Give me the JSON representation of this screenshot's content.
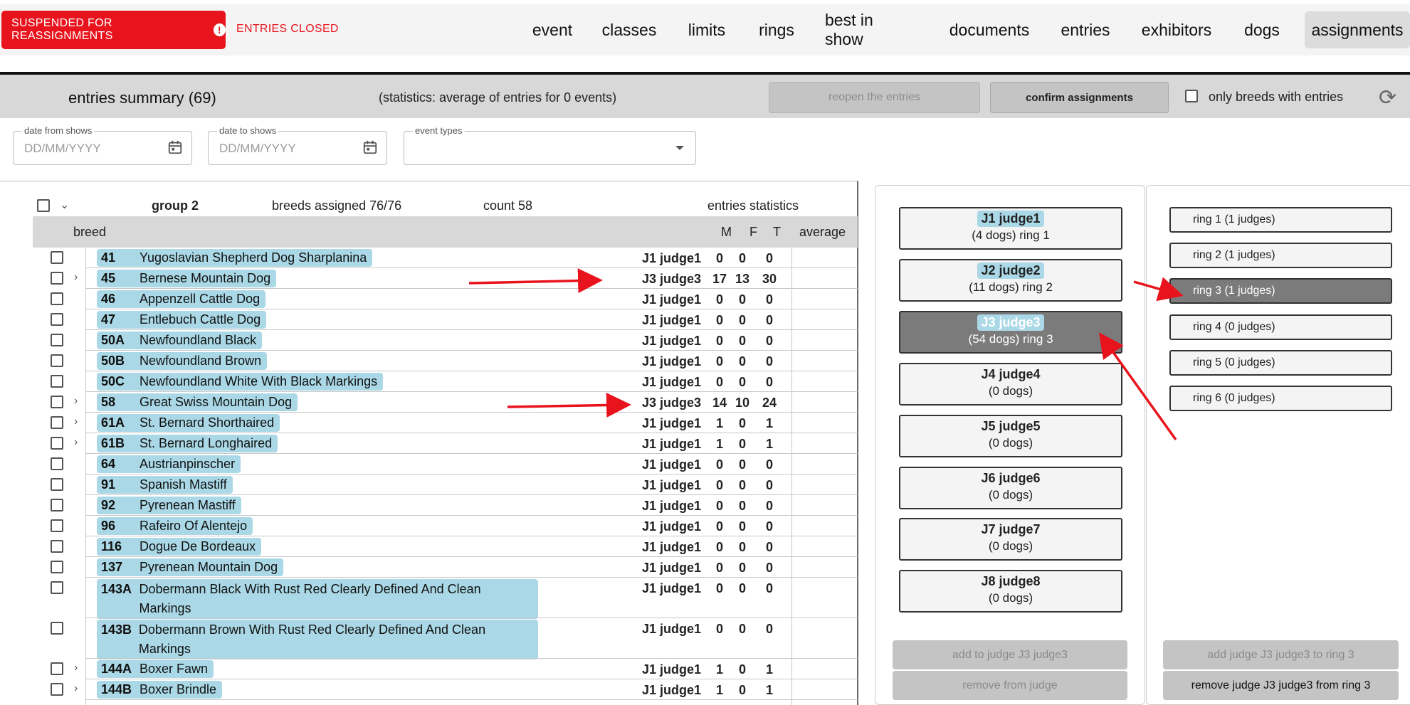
{
  "header": {
    "status_badge": "SUSPENDED FOR REASSIGNMENTS",
    "status_icon": "!",
    "entries_closed": "ENTRIES CLOSED",
    "nav": [
      "event",
      "classes",
      "limits",
      "rings",
      "best in show",
      "documents",
      "entries",
      "exhibitors",
      "dogs",
      "assignments"
    ],
    "active_nav": "assignments"
  },
  "summary": {
    "title": "entries summary (69)",
    "stats": "(statistics: average of entries for 0 events)",
    "reopen": "reopen the entries",
    "confirm": "confirm assignments",
    "only_breeds": "only breeds with entries",
    "refresh_icon": "refresh-icon"
  },
  "filters": {
    "date_from_label": "date from shows",
    "date_from_placeholder": "DD/MM/YYYY",
    "date_to_label": "date to shows",
    "date_to_placeholder": "DD/MM/YYYY",
    "event_types_label": "event types",
    "event_types_value": ""
  },
  "group": {
    "name": "group 2",
    "assigned": "breeds assigned 76/76",
    "count": "count 58",
    "stats": "entries statistics"
  },
  "table": {
    "breed_header": "breed",
    "m_header": "M",
    "f_header": "F",
    "t_header": "T",
    "avg_header": "average",
    "rows": [
      {
        "num": "41",
        "name": "Yugoslavian Shepherd Dog Sharplanina",
        "judge": "J1 judge1",
        "m": "0",
        "f": "0",
        "t": "0",
        "exp": false
      },
      {
        "num": "45",
        "name": "Bernese Mountain Dog",
        "judge": "J3 judge3",
        "m": "17",
        "f": "13",
        "t": "30",
        "exp": true
      },
      {
        "num": "46",
        "name": "Appenzell Cattle Dog",
        "judge": "J1 judge1",
        "m": "0",
        "f": "0",
        "t": "0",
        "exp": false
      },
      {
        "num": "47",
        "name": "Entlebuch Cattle Dog",
        "judge": "J1 judge1",
        "m": "0",
        "f": "0",
        "t": "0",
        "exp": false
      },
      {
        "num": "50A",
        "name": "Newfoundland Black",
        "judge": "J1 judge1",
        "m": "0",
        "f": "0",
        "t": "0",
        "exp": false
      },
      {
        "num": "50B",
        "name": "Newfoundland Brown",
        "judge": "J1 judge1",
        "m": "0",
        "f": "0",
        "t": "0",
        "exp": false
      },
      {
        "num": "50C",
        "name": "Newfoundland White With Black Markings",
        "judge": "J1 judge1",
        "m": "0",
        "f": "0",
        "t": "0",
        "exp": false
      },
      {
        "num": "58",
        "name": "Great Swiss Mountain Dog",
        "judge": "J3 judge3",
        "m": "14",
        "f": "10",
        "t": "24",
        "exp": true
      },
      {
        "num": "61A",
        "name": "St. Bernard Shorthaired",
        "judge": "J1 judge1",
        "m": "1",
        "f": "0",
        "t": "1",
        "exp": true
      },
      {
        "num": "61B",
        "name": "St. Bernard Longhaired",
        "judge": "J1 judge1",
        "m": "1",
        "f": "0",
        "t": "1",
        "exp": true
      },
      {
        "num": "64",
        "name": "Austrianpinscher",
        "judge": "J1 judge1",
        "m": "0",
        "f": "0",
        "t": "0",
        "exp": false
      },
      {
        "num": "91",
        "name": "Spanish Mastiff",
        "judge": "J1 judge1",
        "m": "0",
        "f": "0",
        "t": "0",
        "exp": false
      },
      {
        "num": "92",
        "name": "Pyrenean Mastiff",
        "judge": "J1 judge1",
        "m": "0",
        "f": "0",
        "t": "0",
        "exp": false
      },
      {
        "num": "96",
        "name": "Rafeiro Of Alentejo",
        "judge": "J1 judge1",
        "m": "0",
        "f": "0",
        "t": "0",
        "exp": false
      },
      {
        "num": "116",
        "name": "Dogue De Bordeaux",
        "judge": "J1 judge1",
        "m": "0",
        "f": "0",
        "t": "0",
        "exp": false
      },
      {
        "num": "137",
        "name": "Pyrenean Mountain Dog",
        "judge": "J1 judge1",
        "m": "0",
        "f": "0",
        "t": "0",
        "exp": false
      },
      {
        "num": "143A",
        "name": "Dobermann Black With Rust Red Clearly Defined And Clean Markings",
        "judge": "J1 judge1",
        "m": "0",
        "f": "0",
        "t": "0",
        "exp": false,
        "tall": true
      },
      {
        "num": "143B",
        "name": "Dobermann Brown With Rust Red Clearly Defined And Clean Markings",
        "judge": "J1 judge1",
        "m": "0",
        "f": "0",
        "t": "0",
        "exp": false,
        "tall": true
      },
      {
        "num": "144A",
        "name": "Boxer Fawn",
        "judge": "J1 judge1",
        "m": "1",
        "f": "0",
        "t": "1",
        "exp": true
      },
      {
        "num": "144B",
        "name": "Boxer Brindle",
        "judge": "J1 judge1",
        "m": "1",
        "f": "0",
        "t": "1",
        "exp": true
      }
    ]
  },
  "judges": [
    {
      "name": "J1 judge1",
      "sub": "(4 dogs) ring 1",
      "hl": true
    },
    {
      "name": "J2 judge2",
      "sub": "(11 dogs) ring 2",
      "hl": true
    },
    {
      "name": "J3 judge3",
      "sub": "(54 dogs) ring 3",
      "hl": true,
      "selected": true
    },
    {
      "name": "J4 judge4",
      "sub": "(0 dogs)"
    },
    {
      "name": "J5 judge5",
      "sub": "(0 dogs)"
    },
    {
      "name": "J6 judge6",
      "sub": "(0 dogs)"
    },
    {
      "name": "J7 judge7",
      "sub": "(0 dogs)"
    },
    {
      "name": "J8 judge8",
      "sub": "(0 dogs)"
    }
  ],
  "rings": [
    {
      "name": "ring 1 (1 judges)"
    },
    {
      "name": "ring 2 (1 judges)"
    },
    {
      "name": "ring 3 (1 judges)",
      "selected": true
    },
    {
      "name": "ring 4 (0 judges)"
    },
    {
      "name": "ring 5 (0 judges)"
    },
    {
      "name": "ring 6 (0 judges)"
    }
  ],
  "judge_actions": {
    "add": "add to judge J3 judge3",
    "remove": "remove from judge"
  },
  "ring_actions": {
    "add": "add judge J3 judge3 to ring 3",
    "remove": "remove judge J3 judge3 from ring 3"
  },
  "colors": {
    "alert": "#e8141d",
    "pill": "#aad8e6",
    "selected": "#7b7b7b",
    "arrow": "#e8141d"
  }
}
